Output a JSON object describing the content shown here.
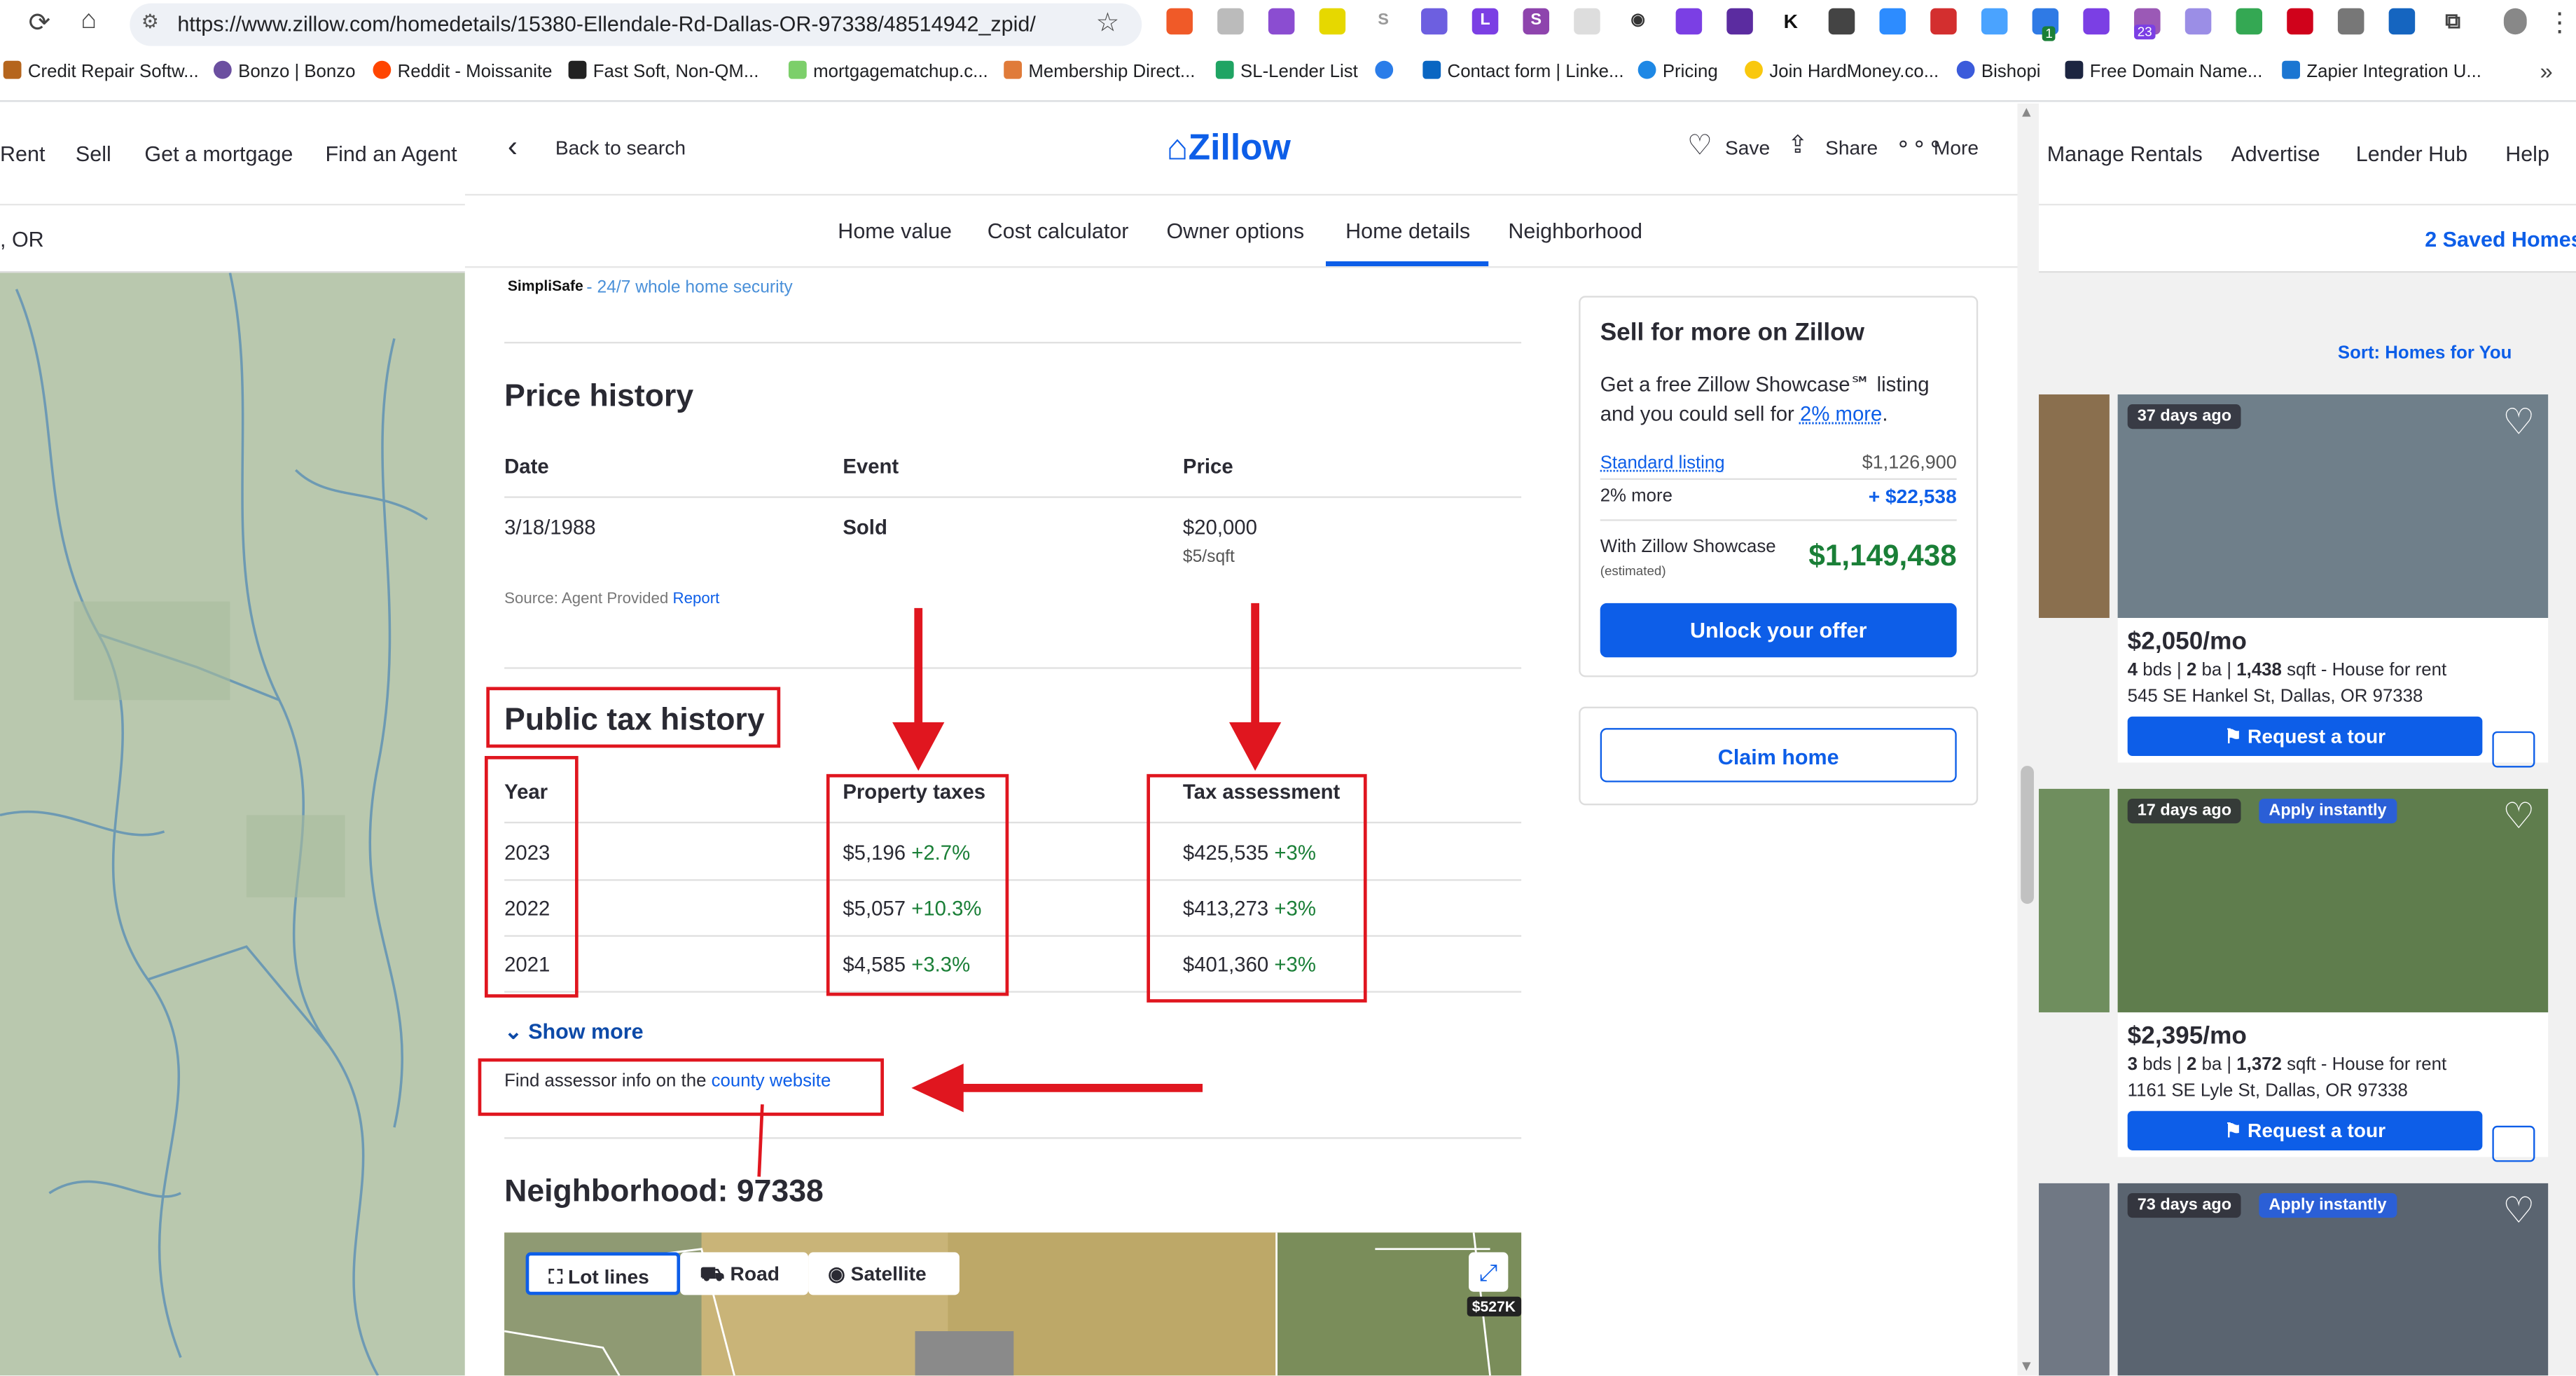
{
  "browser": {
    "url": "https://www.zillow.com/homedetails/15380-Ellendale-Rd-Dallas-OR-97338/48514942_zpid/",
    "bookmarks": [
      "Credit Repair Softw...",
      "Bonzo | Bonzo",
      "Reddit - Moissanite",
      "Fast Soft, Non-QM...",
      "mortgagematchup.c...",
      "Membership Direct...",
      "SL-Lender List",
      "Contact form | Linke...",
      "Pricing",
      "Join HardMoney.co...",
      "Bishopi",
      "Free Domain Name...",
      "Zapier Integration U..."
    ],
    "ext_badge_a": "1",
    "ext_badge_b": "23",
    "ext_letters": [
      "S",
      "L",
      "S",
      "K"
    ]
  },
  "background_site": {
    "nav_left": [
      "Rent",
      "Sell",
      "Get a mortgage",
      "Find an Agent"
    ],
    "nav_right": [
      "Manage Rentals",
      "Advertise",
      "Lender Hub",
      "Help"
    ],
    "search_value": ", OR",
    "saved_homes": "2 Saved Homes",
    "sort": "Sort: Homes for You",
    "listings": [
      {
        "age": "37 days ago",
        "badge": "",
        "price": "$2,050/mo",
        "beds": "4",
        "baths": "2",
        "sqft": "1,438",
        "type": "House for rent",
        "address": "545 SE Hankel St, Dallas, OR 97338",
        "cta": "Request a tour"
      },
      {
        "age": "17 days ago",
        "badge": "Apply instantly",
        "price": "$2,395/mo",
        "beds": "3",
        "baths": "2",
        "sqft": "1,372",
        "type": "House for rent",
        "address": "1161 SE Lyle St, Dallas, OR 97338",
        "cta": "Request a tour"
      },
      {
        "age": "73 days ago",
        "badge": "Apply instantly"
      }
    ],
    "units": {
      "bds": "bds",
      "ba": "ba",
      "sqft": "sqft"
    }
  },
  "modal": {
    "back": "Back to search",
    "logo": "Zillow",
    "actions": {
      "save": "Save",
      "share": "Share",
      "more": "More"
    },
    "tabs": [
      "Home value",
      "Cost calculator",
      "Owner options",
      "Home details",
      "Neighborhood"
    ],
    "active_tab": "Home details",
    "simplisafe": {
      "brand": "SimpliSafe",
      "text": "- 24/7 whole home security"
    },
    "price_history": {
      "title": "Price history",
      "headers": [
        "Date",
        "Event",
        "Price"
      ],
      "rows": [
        {
          "date": "3/18/1988",
          "event": "Sold",
          "price": "$20,000",
          "per_sqft": "$5/sqft"
        }
      ],
      "source_prefix": "Source: Agent Provided",
      "report": "Report"
    },
    "tax_history": {
      "title": "Public tax history",
      "headers": [
        "Year",
        "Property taxes",
        "Tax assessment"
      ],
      "rows": [
        {
          "year": "2023",
          "tax": "$5,196",
          "tax_change": "+2.7%",
          "assess": "$425,535",
          "assess_change": "+3%"
        },
        {
          "year": "2022",
          "tax": "$5,057",
          "tax_change": "+10.3%",
          "assess": "$413,273",
          "assess_change": "+3%"
        },
        {
          "year": "2021",
          "tax": "$4,585",
          "tax_change": "+3.3%",
          "assess": "$401,360",
          "assess_change": "+3%"
        }
      ],
      "show_more": "Show more",
      "assessor_prefix": "Find assessor info on the",
      "assessor_link": "county website"
    },
    "neighborhood": {
      "title": "Neighborhood: 97338",
      "map_buttons": [
        "Lot lines",
        "Road",
        "Satellite"
      ],
      "price_pin": "$527K"
    },
    "sell_panel": {
      "title": "Sell for more on Zillow",
      "desc": "Get a free Zillow Showcase℠ listing and you could sell for",
      "desc_link": "2% more",
      "standard_label": "Standard listing",
      "standard_value": "$1,126,900",
      "more_label": "2% more",
      "more_value": "+ $22,538",
      "showcase_label": "With Zillow Showcase",
      "showcase_note": "(estimated)",
      "showcase_value": "$1,149,438",
      "cta": "Unlock your offer"
    },
    "claim": "Claim home"
  },
  "colors": {
    "brand_blue": "#0d5ee8",
    "positive_green": "#1a7f37",
    "annotation_red": "#e0161f"
  }
}
